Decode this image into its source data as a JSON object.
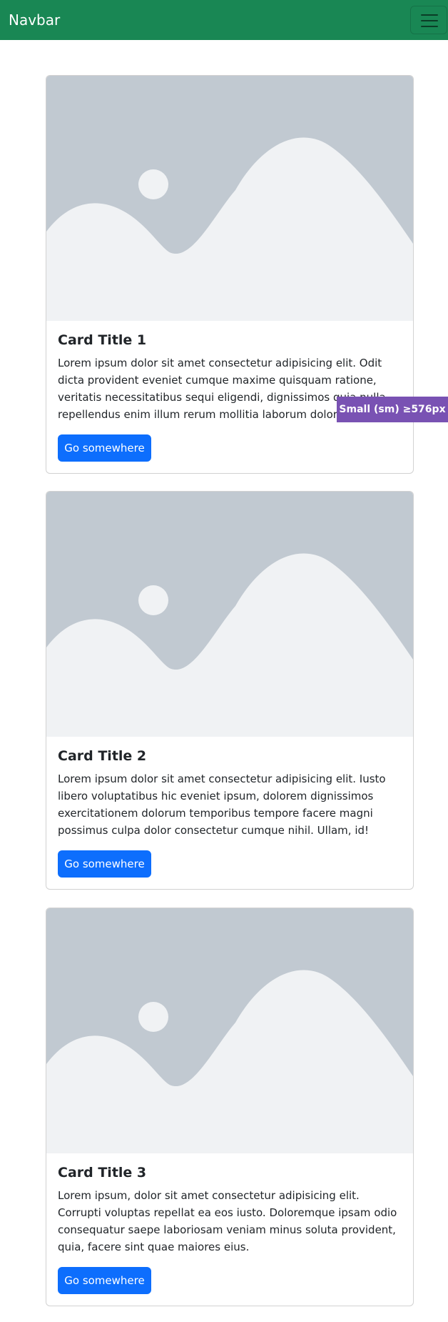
{
  "navbar": {
    "brand": "Navbar",
    "toggler_icon": "hamburger-menu-icon",
    "background_color": "#198754"
  },
  "cards": [
    {
      "image_icon": "image-placeholder-icon",
      "title": "Card Title 1",
      "text": "Lorem ipsum dolor sit amet consectetur adipisicing elit. Odit dicta provident eveniet cumque maxime quisquam ratione, veritatis necessitatibus sequi eligendi, dignissimos quia nulla repellendus enim illum rerum mollitia laborum dolore.",
      "button_label": "Go somewhere"
    },
    {
      "image_icon": "image-placeholder-icon",
      "title": "Card Title 2",
      "text": "Lorem ipsum dolor sit amet consectetur adipisicing elit. Iusto libero voluptatibus hic eveniet ipsum, dolorem dignissimos exercitationem dolorum temporibus tempore facere magni possimus culpa dolor consectetur cumque nihil. Ullam, id!",
      "button_label": "Go somewhere"
    },
    {
      "image_icon": "image-placeholder-icon",
      "title": "Card Title 3",
      "text": "Lorem ipsum, dolor sit amet consectetur adipisicing elit. Corrupti voluptas repellat ea eos iusto. Doloremque ipsam odio consequatur saepe laboriosam veniam minus soluta provident, quia, facere sint quae maiores eius.",
      "button_label": "Go somewhere"
    }
  ],
  "breakpoint_badge": {
    "label": "Small (sm) ≥576px",
    "color": "#7952b3"
  },
  "colors": {
    "primary_button": "#0d6efd",
    "image_placeholder_background": "#c1c9d1",
    "image_placeholder_foreground": "#f0f2f4"
  }
}
